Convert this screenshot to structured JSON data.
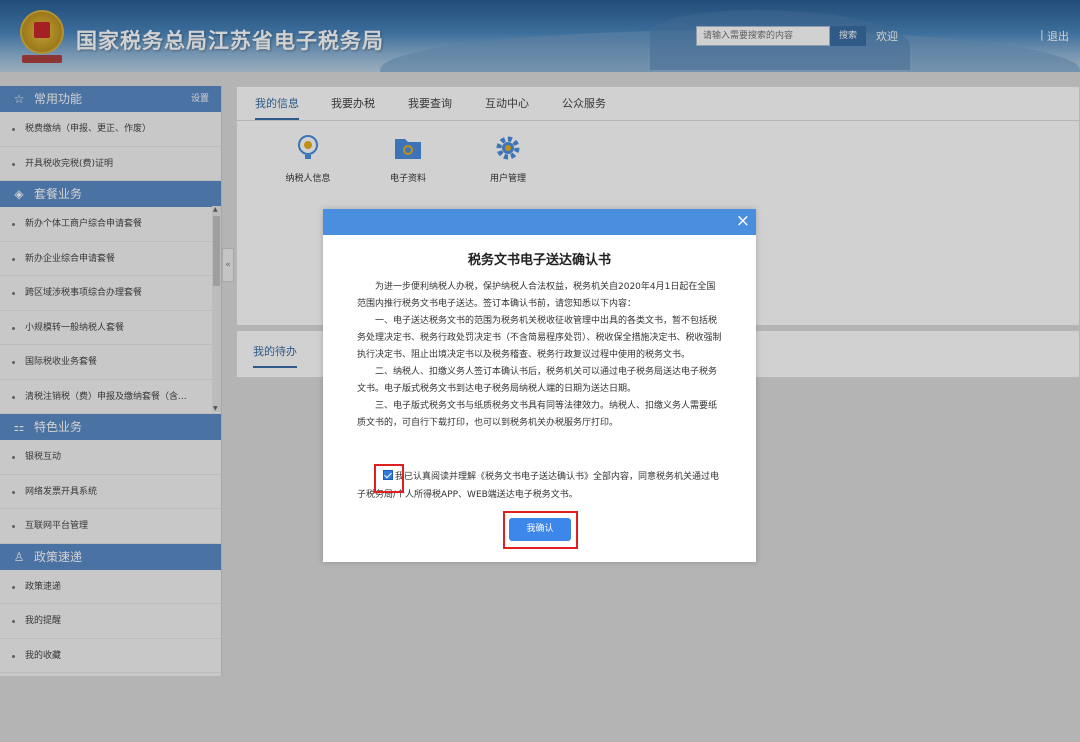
{
  "header": {
    "site_title": "国家税务总局江苏省电子税务局",
    "search_placeholder": "请输入需要搜索的内容",
    "search_button": "搜索",
    "welcome": "欢迎",
    "divider": "|",
    "logout": "退出"
  },
  "sidebar": {
    "sections": [
      {
        "title": "常用功能",
        "icon": "star-icon",
        "action": "设置",
        "items": [
          "税费缴纳（申报、更正、作废）",
          "开具税收完税(费)证明"
        ]
      },
      {
        "title": "套餐业务",
        "icon": "layers-icon",
        "items": [
          "新办个体工商户综合申请套餐",
          "新办企业综合申请套餐",
          "跨区域涉税事项综合办理套餐",
          "小规模转一般纳税人套餐",
          "国际税收业务套餐",
          "清税注销税（费）申报及缴纳套餐（含..."
        ]
      },
      {
        "title": "特色业务",
        "icon": "grid-icon",
        "items": [
          "银税互动",
          "网络发票开具系统",
          "互联网平台管理"
        ]
      },
      {
        "title": "政策速递",
        "icon": "user-icon",
        "items": [
          "政策速递",
          "我的提醒",
          "我的收藏"
        ]
      }
    ],
    "collapse_glyph": "«"
  },
  "main": {
    "tabs": [
      "我的信息",
      "我要办税",
      "我要查询",
      "互动中心",
      "公众服务"
    ],
    "tiles": [
      {
        "label": "纳税人信息",
        "icon": "bulb-icon"
      },
      {
        "label": "电子资料",
        "icon": "folder-icon"
      },
      {
        "label": "用户管理",
        "icon": "gear-icon"
      }
    ],
    "pending_tab": "我的待办"
  },
  "modal": {
    "close": "×",
    "title": "税务文书电子送达确认书",
    "paragraphs": [
      "为进一步便利纳税人办税，保护纳税人合法权益，税务机关自2020年4月1日起在全国范围内推行税务文书电子送达。签订本确认书前，请您知悉以下内容：",
      "一、电子送达税务文书的范围为税务机关税收征收管理中出具的各类文书，暂不包括税务处理决定书、税务行政处罚决定书（不含简易程序处罚）、税收保全措施决定书、税收强制执行决定书、阻止出境决定书以及税务稽查、税务行政复议过程中使用的税务文书。",
      "二、纳税人、扣缴义务人签订本确认书后，税务机关可以通过电子税务局送达电子税务文书。电子版式税务文书到达电子税务局纳税人端的日期为送达日期。",
      "三、电子版式税务文书与纸质税务文书具有同等法律效力。纳税人、扣缴义务人需要纸质文书的，可自行下载打印，也可以到税务机关办税服务厅打印。"
    ],
    "agreement": "我已认真阅读并理解《税务文书电子送达确认书》全部内容，同意税务机关通过电子税务局/个人所得税APP、WEB端送达电子税务文书。",
    "agreement_checked": true,
    "confirm_button": "我确认"
  },
  "colors": {
    "accent": "#4a8ee0",
    "sidebar_header": "#5b8cc6",
    "highlight": "#e02020"
  }
}
